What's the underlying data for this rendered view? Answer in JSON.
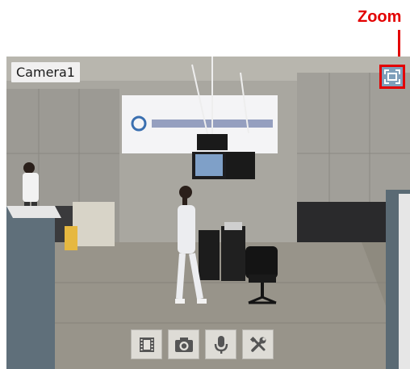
{
  "callout": {
    "label": "Zoom",
    "color": "#e30000"
  },
  "viewer": {
    "camera_name": "Camera1",
    "zoom_icon": "zoom-frame-icon",
    "toolbar": [
      {
        "name": "record-video-button",
        "icon": "film-icon"
      },
      {
        "name": "snapshot-button",
        "icon": "camera-icon"
      },
      {
        "name": "microphone-button",
        "icon": "microphone-icon"
      },
      {
        "name": "settings-button",
        "icon": "tools-icon"
      }
    ]
  },
  "colors": {
    "zoom_button": "#7f9fba",
    "toolbar_icon": "#555555"
  }
}
